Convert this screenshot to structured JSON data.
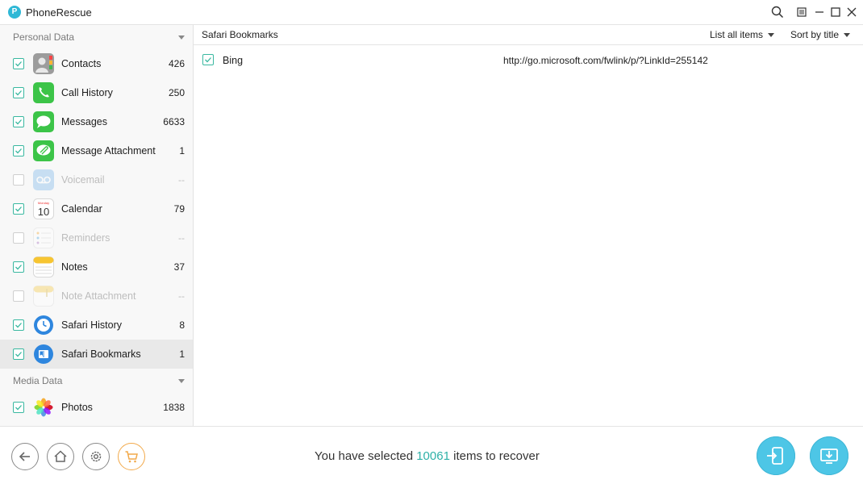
{
  "app": {
    "title": "PhoneRescue"
  },
  "sidebar": {
    "sections": [
      {
        "name": "Personal Data",
        "items": [
          {
            "label": "Contacts",
            "count": "426",
            "checked": true,
            "disabled": false,
            "icon": "contacts-icon"
          },
          {
            "label": "Call History",
            "count": "250",
            "checked": true,
            "disabled": false,
            "icon": "phone-icon"
          },
          {
            "label": "Messages",
            "count": "6633",
            "checked": true,
            "disabled": false,
            "icon": "messages-icon"
          },
          {
            "label": "Message Attachment",
            "count": "1",
            "checked": true,
            "disabled": false,
            "icon": "attachment-icon"
          },
          {
            "label": "Voicemail",
            "count": "--",
            "checked": false,
            "disabled": true,
            "icon": "voicemail-icon"
          },
          {
            "label": "Calendar",
            "count": "79",
            "checked": true,
            "disabled": false,
            "icon": "calendar-icon"
          },
          {
            "label": "Reminders",
            "count": "--",
            "checked": false,
            "disabled": true,
            "icon": "reminders-icon"
          },
          {
            "label": "Notes",
            "count": "37",
            "checked": true,
            "disabled": false,
            "icon": "notes-icon"
          },
          {
            "label": "Note Attachment",
            "count": "--",
            "checked": false,
            "disabled": true,
            "icon": "note-attachment-icon"
          },
          {
            "label": "Safari History",
            "count": "8",
            "checked": true,
            "disabled": false,
            "icon": "safari-history-icon"
          },
          {
            "label": "Safari Bookmarks",
            "count": "1",
            "checked": true,
            "disabled": false,
            "selected": true,
            "icon": "safari-bookmarks-icon"
          }
        ]
      },
      {
        "name": "Media Data",
        "items": [
          {
            "label": "Photos",
            "count": "1838",
            "checked": true,
            "disabled": false,
            "icon": "photos-icon"
          }
        ]
      }
    ]
  },
  "main": {
    "breadcrumb": "Safari Bookmarks",
    "filter_label": "List all items",
    "sort_label": "Sort by title",
    "rows": [
      {
        "title": "Bing",
        "url": "http://go.microsoft.com/fwlink/p/?LinkId=255142",
        "checked": true
      }
    ]
  },
  "footer": {
    "status_prefix": "You have selected",
    "status_count": "10061",
    "status_suffix": "items to recover"
  },
  "colors": {
    "accent": "#2fb1a8",
    "checkbox": "#39b8a0",
    "action": "#4dc6e6",
    "cart": "#f2a94a"
  },
  "calendar_icon_text": {
    "month": "Monday",
    "day": "10"
  }
}
